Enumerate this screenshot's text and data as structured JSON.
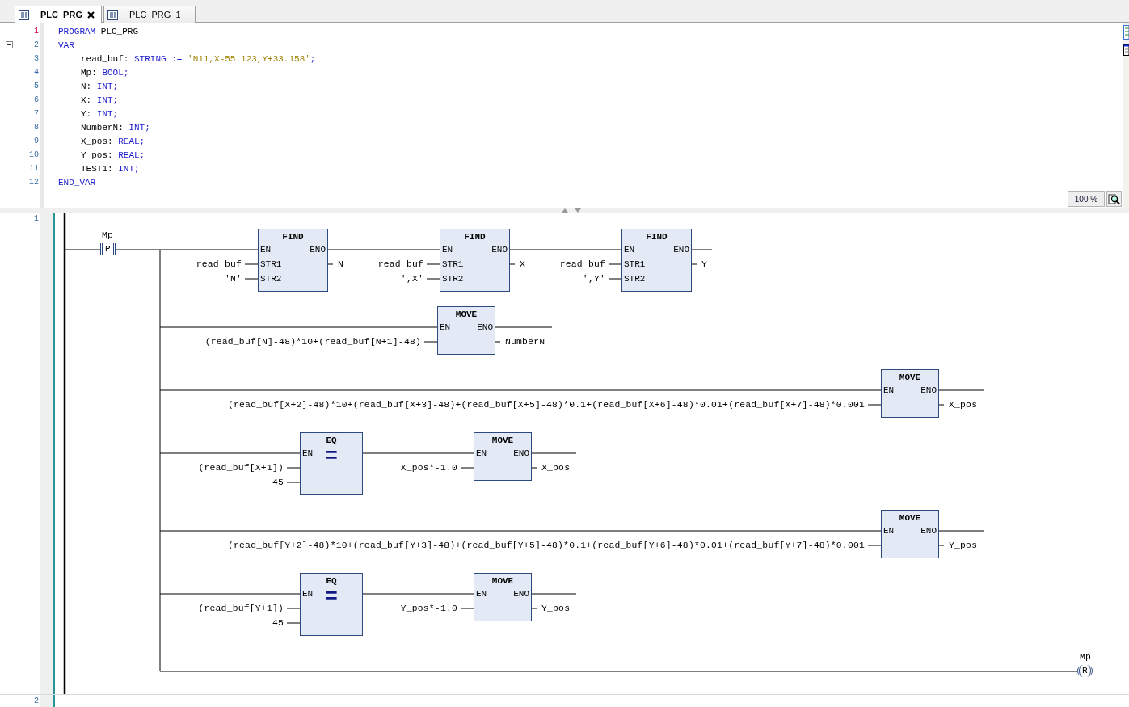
{
  "tabs": [
    {
      "label": "PLC_PRG",
      "selected": true,
      "closable": true
    },
    {
      "label": "PLC_PRG_1",
      "selected": false,
      "closable": false
    }
  ],
  "declaration": {
    "lines": [
      {
        "number": "1",
        "current": true,
        "indented": false,
        "segments": [
          {
            "kind": "keyword",
            "text": "PROGRAM"
          },
          {
            "kind": "plain",
            "text": " PLC_PRG"
          }
        ]
      },
      {
        "number": "2",
        "current": false,
        "indented": false,
        "expanded": true,
        "segments": [
          {
            "kind": "keyword",
            "text": "VAR"
          }
        ]
      },
      {
        "number": "3",
        "current": false,
        "indented": true,
        "segments": [
          {
            "kind": "plain",
            "text": "read_buf: "
          },
          {
            "kind": "keyword",
            "text": "STRING := "
          },
          {
            "kind": "string",
            "text": "'N11,X-55.123,Y+33.158'"
          },
          {
            "kind": "keyword",
            "text": ";"
          }
        ]
      },
      {
        "number": "4",
        "current": false,
        "indented": true,
        "segments": [
          {
            "kind": "plain",
            "text": "Mp: "
          },
          {
            "kind": "keyword",
            "text": "BOOL;"
          }
        ]
      },
      {
        "number": "5",
        "current": false,
        "indented": true,
        "segments": [
          {
            "kind": "plain",
            "text": "N: "
          },
          {
            "kind": "keyword",
            "text": "INT;"
          }
        ]
      },
      {
        "number": "6",
        "current": false,
        "indented": true,
        "segments": [
          {
            "kind": "plain",
            "text": "X: "
          },
          {
            "kind": "keyword",
            "text": "INT;"
          }
        ]
      },
      {
        "number": "7",
        "current": false,
        "indented": true,
        "segments": [
          {
            "kind": "plain",
            "text": "Y: "
          },
          {
            "kind": "keyword",
            "text": "INT;"
          }
        ]
      },
      {
        "number": "8",
        "current": false,
        "indented": true,
        "segments": [
          {
            "kind": "plain",
            "text": "NumberN: "
          },
          {
            "kind": "keyword",
            "text": "INT;"
          }
        ]
      },
      {
        "number": "9",
        "current": false,
        "indented": true,
        "segments": [
          {
            "kind": "plain",
            "text": "X_pos: "
          },
          {
            "kind": "keyword",
            "text": "REAL;"
          }
        ]
      },
      {
        "number": "10",
        "current": false,
        "indented": true,
        "segments": [
          {
            "kind": "plain",
            "text": "Y_pos: "
          },
          {
            "kind": "keyword",
            "text": "REAL;"
          }
        ]
      },
      {
        "number": "11",
        "current": false,
        "indented": true,
        "segments": [
          {
            "kind": "plain",
            "text": "TEST1: "
          },
          {
            "kind": "keyword",
            "text": "INT;"
          }
        ]
      },
      {
        "number": "12",
        "current": false,
        "indented": false,
        "segments": [
          {
            "kind": "keyword",
            "text": "END_VAR"
          }
        ]
      }
    ]
  },
  "zoom": "100 %",
  "networks": [
    {
      "number": "1",
      "contact": {
        "variable": "Mp",
        "type": "P"
      },
      "blocks": [
        {
          "kind": "find",
          "name": "FIND",
          "en": "EN",
          "eno": "ENO",
          "inputs": [
            {
              "pin": "STR1",
              "value": "read_buf"
            },
            {
              "pin": "STR2",
              "value": "'N'"
            }
          ],
          "output": "N"
        },
        {
          "kind": "find",
          "name": "FIND",
          "en": "EN",
          "eno": "ENO",
          "inputs": [
            {
              "pin": "STR1",
              "value": "read_buf"
            },
            {
              "pin": "STR2",
              "value": "',X'"
            }
          ],
          "output": "X"
        },
        {
          "kind": "find",
          "name": "FIND",
          "en": "EN",
          "eno": "ENO",
          "inputs": [
            {
              "pin": "STR1",
              "value": "read_buf"
            },
            {
              "pin": "STR2",
              "value": "',Y'"
            }
          ],
          "output": "Y"
        },
        {
          "kind": "move",
          "name": "MOVE",
          "en": "EN",
          "eno": "ENO",
          "inputs": [
            {
              "value": "(read_buf[N]-48)*10+(read_buf[N+1]-48)"
            }
          ],
          "output": "NumberN"
        },
        {
          "kind": "move",
          "name": "MOVE",
          "en": "EN",
          "eno": "ENO",
          "inputs": [
            {
              "value": "(read_buf[X+2]-48)*10+(read_buf[X+3]-48)+(read_buf[X+5]-48)*0.1+(read_buf[X+6]-48)*0.01+(read_buf[X+7]-48)*0.001"
            }
          ],
          "output": "X_pos"
        },
        {
          "kind": "compare",
          "name": "EQ",
          "symbol": "=",
          "en": "EN",
          "inputs": [
            {
              "value": "(read_buf[X+1])"
            },
            {
              "value": "45"
            }
          ]
        },
        {
          "kind": "move",
          "name": "MOVE",
          "en": "EN",
          "eno": "ENO",
          "inputs": [
            {
              "value": "X_pos*-1.0"
            }
          ],
          "output": "X_pos"
        },
        {
          "kind": "move",
          "name": "MOVE",
          "en": "EN",
          "eno": "ENO",
          "inputs": [
            {
              "value": "(read_buf[Y+2]-48)*10+(read_buf[Y+3]-48)+(read_buf[Y+5]-48)*0.1+(read_buf[Y+6]-48)*0.01+(read_buf[Y+7]-48)*0.001"
            }
          ],
          "output": "Y_pos"
        },
        {
          "kind": "compare",
          "name": "EQ",
          "symbol": "=",
          "en": "EN",
          "inputs": [
            {
              "value": "(read_buf[Y+1])"
            },
            {
              "value": "45"
            }
          ]
        },
        {
          "kind": "move",
          "name": "MOVE",
          "en": "EN",
          "eno": "ENO",
          "inputs": [
            {
              "value": "Y_pos*-1.0"
            }
          ],
          "output": "Y_pos"
        }
      ],
      "coil": {
        "variable": "Mp",
        "type": "R"
      }
    },
    {
      "number": "2"
    }
  ]
}
